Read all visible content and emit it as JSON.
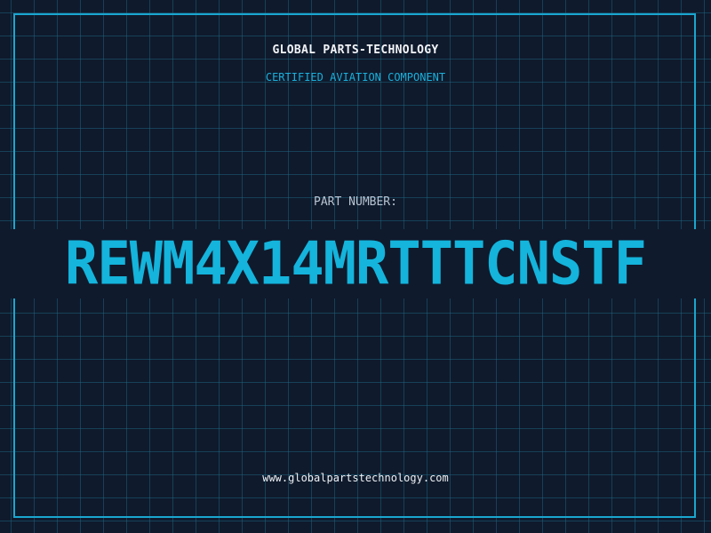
{
  "header": {
    "company": "GLOBAL PARTS-TECHNOLOGY",
    "subtitle": "CERTIFIED AVIATION COMPONENT"
  },
  "part": {
    "label": "PART NUMBER:",
    "number": "REWM4X14MRTTTCNSTF"
  },
  "footer": {
    "url": "www.globalpartstechnology.com"
  },
  "colors": {
    "background": "#0f1a2c",
    "accent": "#14b4dc",
    "grid": "#1e6e8c",
    "frame": "#1aa6cf"
  }
}
